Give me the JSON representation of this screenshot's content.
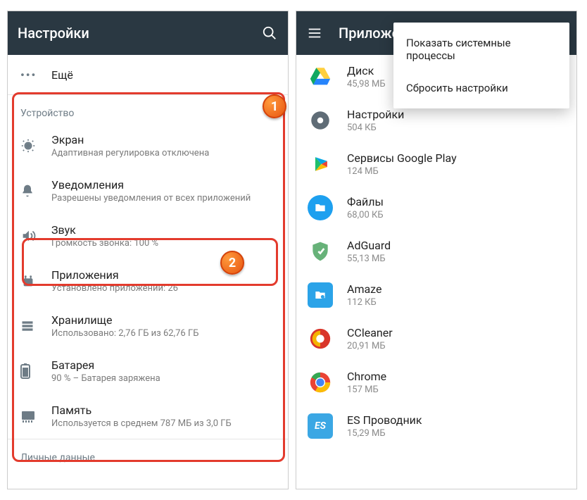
{
  "left": {
    "title": "Настройки",
    "more_label": "Ещё",
    "section_device": "Устройство",
    "items": [
      {
        "title": "Экран",
        "sub": "Адаптивная регулировка отключена",
        "icon": "display"
      },
      {
        "title": "Уведомления",
        "sub": "Разрешены уведомления от всех приложений",
        "icon": "bell"
      },
      {
        "title": "Звук",
        "sub": "Громкость звонка: 100 %",
        "icon": "sound"
      },
      {
        "title": "Приложения",
        "sub": "Установлено приложений: 26",
        "icon": "apps"
      },
      {
        "title": "Хранилище",
        "sub": "Использовано: 2,76 ГБ из 62,76 ГБ",
        "icon": "storage"
      },
      {
        "title": "Батарея",
        "sub": "90 % – Батарея заряжена",
        "icon": "battery"
      },
      {
        "title": "Память",
        "sub": "Используется в среднем 787 МБ из 3,0 ГБ",
        "icon": "memory"
      }
    ],
    "section_personal": "Личные данные",
    "badge1": "1",
    "badge2": "2"
  },
  "right": {
    "title": "Приложе",
    "menu": {
      "item1": "Показать системные процессы",
      "item2": "Сбросить настройки"
    },
    "apps": [
      {
        "name": "Диск",
        "size": "45,98 МБ",
        "color": "drive"
      },
      {
        "name": "Настройки",
        "size": "504 КБ",
        "color": "settings"
      },
      {
        "name": "Сервисы Google Play",
        "size": "124 МБ",
        "color": "play"
      },
      {
        "name": "Файлы",
        "size": "68,00 КБ",
        "color": "files"
      },
      {
        "name": "AdGuard",
        "size": "55,13 МБ",
        "color": "adguard"
      },
      {
        "name": "Amaze",
        "size": "112 КБ",
        "color": "amaze"
      },
      {
        "name": "CCleaner",
        "size": "20,91 МБ",
        "color": "ccleaner"
      },
      {
        "name": "Chrome",
        "size": "157 МБ",
        "color": "chrome"
      },
      {
        "name": "ES Проводник",
        "size": "15,29 МБ",
        "color": "es"
      }
    ]
  }
}
